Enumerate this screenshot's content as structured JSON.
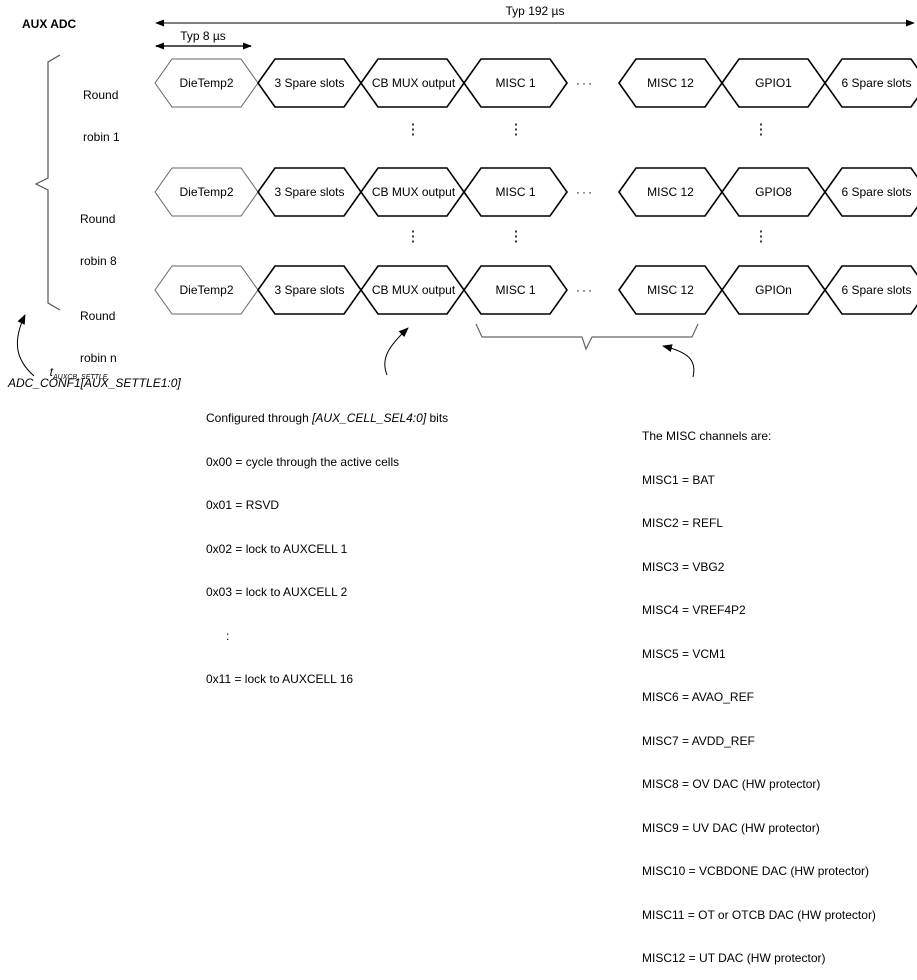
{
  "title": "AUX ADC",
  "total_period_label": "Typ 192 µs",
  "slot_period_label": "Typ 8 µs",
  "rows": [
    {
      "label_line1": "Round",
      "label_line2": "robin 1",
      "slots": [
        "DieTemp2",
        "3 Spare slots",
        "CB MUX output",
        "MISC 1",
        "MISC 12",
        "GPIO1",
        "6 Spare slots"
      ]
    },
    {
      "label_line1": "Round",
      "label_line2": "robin 8",
      "slots": [
        "DieTemp2",
        "3 Spare slots",
        "CB MUX output",
        "MISC 1",
        "MISC 12",
        "GPIO8",
        "6 Spare slots"
      ]
    },
    {
      "label_line1": "Round",
      "label_line2": "robin n",
      "slots": [
        "DieTemp2",
        "3 Spare slots",
        "CB MUX output",
        "MISC 1",
        "MISC 12",
        "GPIOn",
        "6 Spare slots"
      ]
    }
  ],
  "horizontal_ellipsis": "···",
  "vertical_ellipsis": "⋮",
  "settle": {
    "symbol": "t",
    "subscript": "AUXCB_SETTLE",
    "register": "ADC_CONF1[AUX_SETTLE1:0]"
  },
  "cell_sel": {
    "intro_prefix": "Configured through ",
    "intro_field": "[AUX_CELL_SEL4:0]",
    "intro_suffix": " bits",
    "lines": [
      "0x00 = cycle through the active cells",
      "0x01 = RSVD",
      "0x02 = lock to AUXCELL 1",
      "0x03 = lock to AUXCELL 2",
      "      :",
      "0x11 = lock to AUXCELL 16"
    ]
  },
  "misc_channels": {
    "heading": "The MISC channels are:",
    "lines": [
      "MISC1 = BAT",
      "MISC2 = REFL",
      "MISC3 = VBG2",
      "MISC4 = VREF4P2",
      "MISC5 = VCM1",
      "MISC6 = AVAO_REF",
      "MISC7 = AVDD_REF",
      "MISC8 = OV DAC (HW protector)",
      "MISC9 = UV DAC (HW protector)",
      "MISC10 = VCBDONE DAC (HW protector)",
      "MISC11 = OT or OTCB DAC (HW protector)",
      "MISC12 = UT DAC (HW protector)"
    ]
  }
}
